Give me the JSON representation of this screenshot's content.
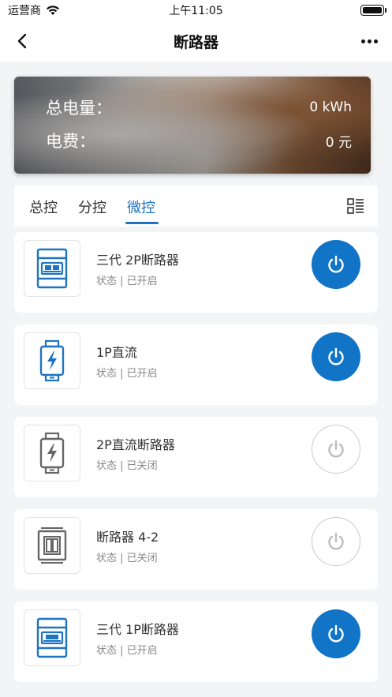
{
  "status_bar": {
    "carrier": "运营商",
    "time": "上午11:05"
  },
  "nav": {
    "title": "断路器"
  },
  "energy": {
    "total_label": "总电量：",
    "total_value": "0 kWh",
    "fee_label": "电费：",
    "fee_value": "0 元"
  },
  "tabs": [
    {
      "label": "总控"
    },
    {
      "label": "分控"
    },
    {
      "label": "微控",
      "active": true
    }
  ],
  "devices": [
    {
      "name": "三代 2P断路器",
      "status": "状态 | 已开启",
      "on": true,
      "icon": "breaker-gen3-icon"
    },
    {
      "name": "1P直流",
      "status": "状态 | 已开启",
      "on": true,
      "icon": "dc-breaker-icon"
    },
    {
      "name": "2P直流断路器",
      "status": "状态 | 已关闭",
      "on": false,
      "icon": "dc-breaker-icon"
    },
    {
      "name": "断路器 4-2",
      "status": "状态 | 已关闭",
      "on": false,
      "icon": "breaker-panel-icon"
    },
    {
      "name": "三代 1P断路器",
      "status": "状态 | 已开启",
      "on": true,
      "icon": "breaker-gen3-icon"
    }
  ],
  "colors": {
    "accent": "#1274c7",
    "on_icon": "#1f74c1",
    "off_icon": "#666666"
  }
}
